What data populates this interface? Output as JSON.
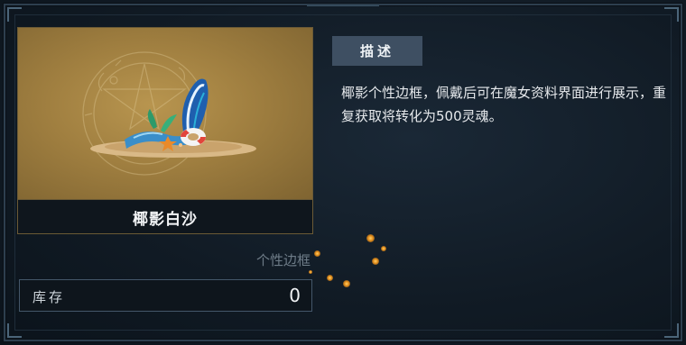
{
  "item": {
    "name": "椰影白沙",
    "category": "个性边框",
    "stock_label": "库存",
    "stock_value": "0"
  },
  "description": {
    "tab_label": "描述",
    "text": "椰影个性边框，佩戴后可在魔女资料界面进行展示，重复获取将转化为500灵魂。"
  },
  "colors": {
    "card_bg": "#a88744",
    "panel_bg": "#111b25",
    "tab_bg": "#3e4f62"
  },
  "icons": [
    "surfboard-icon",
    "swim-ring-icon",
    "starfish-icon",
    "magic-circle-decor"
  ]
}
